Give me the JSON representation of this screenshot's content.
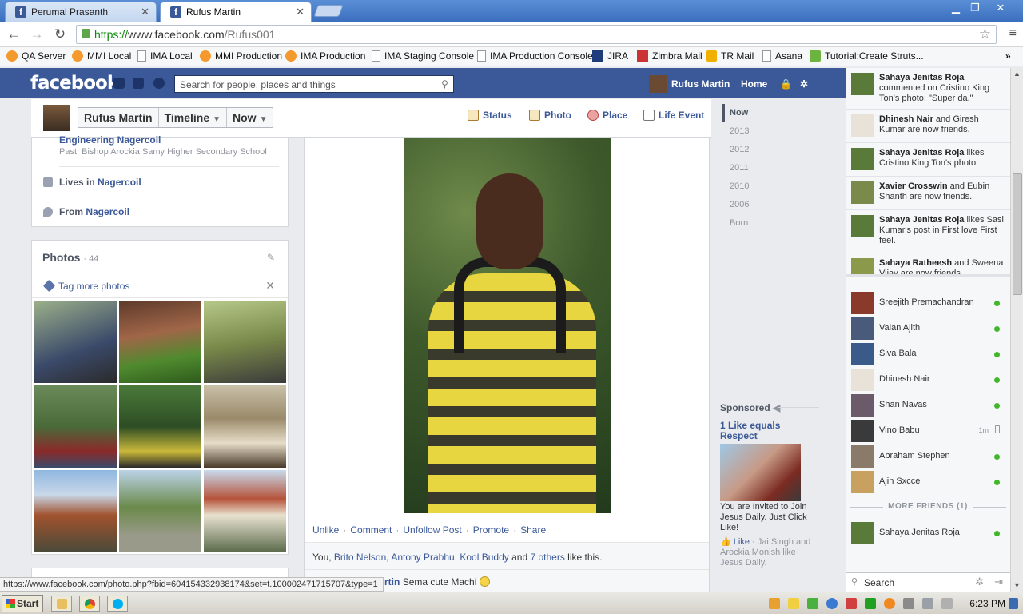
{
  "browser": {
    "tabs": [
      {
        "title": "Perumal Prasanth"
      },
      {
        "title": "Rufus Martin"
      }
    ],
    "url": {
      "scheme": "https://",
      "host": "www.facebook.com",
      "path": "/Rufus001"
    },
    "bookmarks": [
      "QA Server",
      "MMI Local",
      "IMA Local",
      "MMI Production",
      "IMA Production",
      "IMA Staging Console",
      "IMA Production Console",
      "JIRA",
      "Zimbra Mail",
      "TR Mail",
      "Asana",
      "Tutorial:Create Struts..."
    ],
    "more_bookmarks": "»",
    "status_url": "https://www.facebook.com/photo.php?fbid=604154332938174&set=t.100002471715707&type=1"
  },
  "fb": {
    "logo": "facebook",
    "search_placeholder": "Search for people, places and things",
    "user_name": "Rufus Martin",
    "home": "Home"
  },
  "profile": {
    "crumbs": [
      "Rufus Martin",
      "Timeline",
      "Now"
    ],
    "composer": [
      "Status",
      "Photo",
      "Place",
      "Life Event"
    ]
  },
  "about": {
    "education": "Engineering Nagercoil",
    "past": "Past: Bishop Arockia Samy Higher Secondary School",
    "lives_prefix": "Lives in ",
    "lives": "Nagercoil",
    "from_prefix": "From ",
    "from": "Nagercoil"
  },
  "photos": {
    "title": "Photos",
    "count": "· 44",
    "tag_more": "Tag more photos"
  },
  "story": {
    "actions": [
      "Unlike",
      "Comment",
      "Unfollow Post",
      "Promote",
      "Share"
    ],
    "likes_prefix": "You, ",
    "likers": [
      "Brito Nelson",
      "Antony Prabhu",
      "Kool Buddy"
    ],
    "likes_and": " and ",
    "likes_others": "7 others",
    "likes_suffix": " like this.",
    "comment_author": "rtin",
    "comment_text": "Sema cute Machi"
  },
  "scrubber": [
    "Now",
    "2013",
    "2012",
    "2011",
    "2010",
    "2006",
    "Born"
  ],
  "sponsored": {
    "label": "Sponsored",
    "title": "1 Like equals Respect",
    "text": "You are Invited to Join Jesus Daily. Just Click Like!",
    "like": "Like",
    "social": " · Jai Singh and Arockia Monish like Jesus Daily."
  },
  "ticker": [
    {
      "name": "Sahaya Jenitas Roja",
      "text": " commented on Cristino King Ton's photo: \"Super da.\""
    },
    {
      "name": "Dhinesh Nair",
      "text": " and Giresh Kumar are now friends."
    },
    {
      "name": "Sahaya Jenitas Roja",
      "text": " likes Cristino King Ton's photo."
    },
    {
      "name": "Xavier Crosswin",
      "text": " and Eubin Shanth are now friends."
    },
    {
      "name": "Sahaya Jenitas Roja",
      "text": " likes Sasi Kumar's post in First love First feel."
    },
    {
      "name": "Sahaya Ratheesh",
      "text": " and Sweena Vijay are now friends."
    }
  ],
  "chat": [
    {
      "name": "Sreejith Premachandran",
      "status": "online"
    },
    {
      "name": "Valan Ajith",
      "status": "online"
    },
    {
      "name": "Siva Bala",
      "status": "online"
    },
    {
      "name": "Dhinesh Nair",
      "status": "online"
    },
    {
      "name": "Shan Navas",
      "status": "online"
    },
    {
      "name": "Vino Babu",
      "status": "mobile",
      "idle": "1m"
    },
    {
      "name": "Abraham Stephen",
      "status": "online"
    },
    {
      "name": "Ajin Sxcce",
      "status": "online"
    }
  ],
  "more_friends": "MORE FRIENDS (1)",
  "more_friend": {
    "name": "Sahaya Jenitas Roja"
  },
  "chat_search": "Search",
  "taskbar": {
    "start": "Start",
    "clock": "6:23 PM"
  },
  "colors": {
    "fb_blue": "#3b5998",
    "online": "#42b72a"
  }
}
